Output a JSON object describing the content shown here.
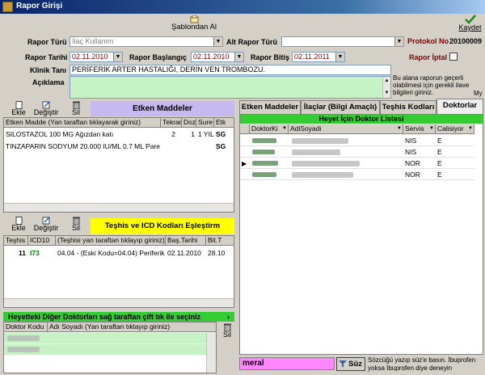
{
  "window": {
    "title": "Rapor Girişi"
  },
  "toolbar": {
    "template_label": "Şablondan Al",
    "save_label": "Kaydet"
  },
  "form": {
    "rapor_turu_label": "Rapor Türü",
    "rapor_turu_value": "İlaç Kullanım",
    "alt_rapor_turu_label": "Alt Rapor Türü",
    "alt_rapor_turu_value": "",
    "protokol_label": "Protokol No",
    "protokol_value": "20100009",
    "rapor_tarihi_label": "Rapor Tarihi",
    "rapor_tarihi_value": "02.11.2010",
    "rapor_baslangic_label": "Rapor Başlangıç",
    "rapor_baslangic_value": "02.11.2010",
    "rapor_bitis_label": "Rapor Bitiş",
    "rapor_bitis_value": "02.11.2011",
    "rapor_iptal_label": "Rapor İptal",
    "klinik_tani_label": "Klinik Tanı",
    "klinik_tani_value": "PERİFERİK ARTER HASTALIĞI, DERİN VEN TROMBOZU.",
    "aciklama_label": "Açıklama",
    "aciklama_value": "",
    "hint": "Bu alana raporun geçerli olabilmesi için gerekli ilave bilgileri giriniz.",
    "hint_cut": "My"
  },
  "etken": {
    "add_label": "Ekle",
    "change_label": "Değiştir",
    "delete_label": "Sil",
    "header_title": "Etken Maddeler",
    "columns": [
      "Etken Madde (Yan taraftan tıklayarak giriniz)",
      "Tekrar",
      "Doz",
      "Sure",
      "Etk"
    ],
    "rows": [
      {
        "name": "SILOSTAZOL 100 MG  Ağızdan katı",
        "tekrar": "2",
        "doz": "1",
        "sure": "1 YIL",
        "etk": "SG"
      },
      {
        "name": "TINZAPARIN SODYUM 20.000 IU/ML 0.7 ML  Pare",
        "tekrar": "",
        "doz": "",
        "sure": "",
        "etk": "SG"
      }
    ]
  },
  "teshis": {
    "add_label": "Ekle",
    "change_label": "Değiştir",
    "delete_label": "Sil",
    "header_title": "Teşhis ve ICD Kodları Eşleştirm",
    "columns": [
      "Teşhis",
      "ICD10",
      "(Teşhisi yan taraftan tıklayıp giriniz)",
      "Baş.Tarihi",
      "Bit.T"
    ],
    "rows": [
      {
        "teshis": "11",
        "icd10": "I73",
        "desc": "04.04 - (Eski Kodu=04.04) Periferik v",
        "bas": "02.11.2010",
        "bit": "28.10"
      }
    ]
  },
  "heyet_diger": {
    "header_title": "Heyetteki Diğer Doktorları sağ taraftan çift tık ile seçiniz",
    "columns": [
      "Doktor Kodu",
      "Adı Soyadı (Yan taraftan tıklayıp giriniz)"
    ],
    "delete_label": "Sil"
  },
  "tabs": [
    {
      "label": "Etken Maddeler"
    },
    {
      "label": "İlaçlar (Bilgi Amaçlı)"
    },
    {
      "label": "Teşhis Kodları"
    },
    {
      "label": "Doktorlar"
    }
  ],
  "doktorlar": {
    "header_title": "Heyet İçin Doktor Listesi",
    "columns": [
      "DoktorKi",
      "AdiSoyadi",
      "Servis",
      "Calisiyor"
    ],
    "rows": [
      {
        "servis": "NIS",
        "calisiyor": "E"
      },
      {
        "servis": "NIS",
        "calisiyor": "E"
      },
      {
        "servis": "NOR",
        "calisiyor": "E"
      },
      {
        "servis": "NOR",
        "calisiyor": "E"
      }
    ]
  },
  "search": {
    "value": "meral",
    "button_label": "Süz",
    "hint": "Sözcüğü yazıp süz'e basın. İbuprofen yoksa İbuprofen diye deneyin"
  },
  "colors": {
    "title_bar": "#0a246a",
    "etken_header": "#c6b8f0",
    "teshis_header": "#ffff00",
    "heyet_green": "#33cc33",
    "search_pink": "#ff88ff",
    "protocol_red": "#800000"
  }
}
